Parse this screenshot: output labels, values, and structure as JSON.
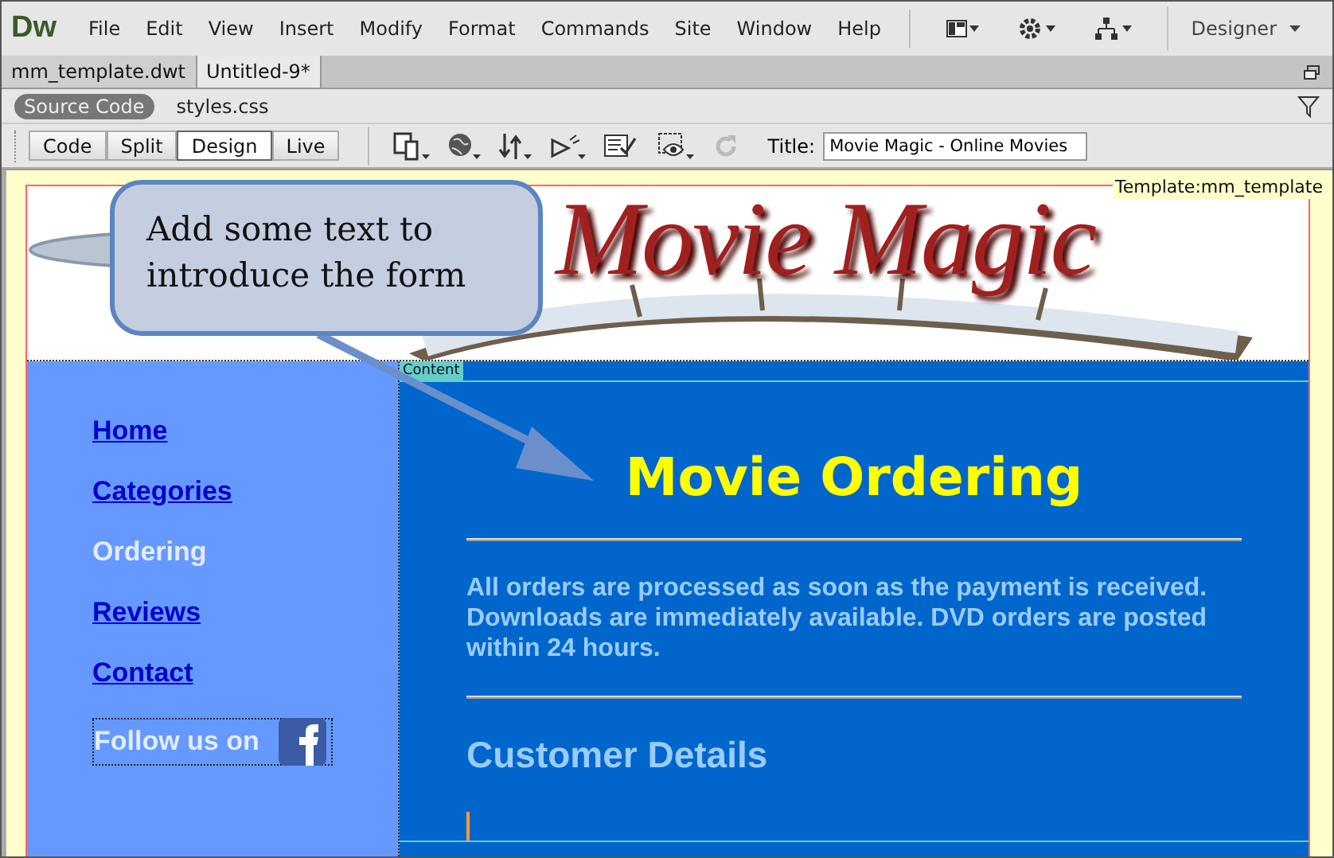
{
  "app": {
    "logo": "Dw",
    "menu": [
      "File",
      "Edit",
      "View",
      "Insert",
      "Modify",
      "Format",
      "Commands",
      "Site",
      "Window",
      "Help"
    ],
    "workspace": "Designer"
  },
  "document_tabs": [
    {
      "label": "mm_template.dwt",
      "selected": false
    },
    {
      "label": "Untitled-9*",
      "selected": true
    }
  ],
  "related_files": [
    {
      "label": "Source Code",
      "selected": true
    },
    {
      "label": "styles.css",
      "selected": false
    }
  ],
  "view_buttons": [
    {
      "label": "Code",
      "selected": false
    },
    {
      "label": "Split",
      "selected": false
    },
    {
      "label": "Design",
      "selected": true
    },
    {
      "label": "Live",
      "selected": false
    }
  ],
  "title_field": {
    "label": "Title:",
    "value": "Movie Magic - Online Movies"
  },
  "template_label": "Template:mm_template",
  "header": {
    "logo_text": "Movie Magic"
  },
  "region_tag": "Content",
  "nav": [
    {
      "label": "Home",
      "selected": false
    },
    {
      "label": "Categories",
      "selected": false
    },
    {
      "label": "Ordering",
      "selected": true
    },
    {
      "label": "Reviews",
      "selected": false
    },
    {
      "label": "Contact",
      "selected": false
    }
  ],
  "follow": {
    "label": "Follow us on"
  },
  "content": {
    "heading": "Movie Ordering",
    "intro": "All orders are processed as soon as the payment is received. Downloads are immediately available. DVD orders are posted within 24 hours.",
    "subheading": "Customer Details"
  },
  "callout": {
    "text": "Add some text to\nintroduce the form"
  }
}
